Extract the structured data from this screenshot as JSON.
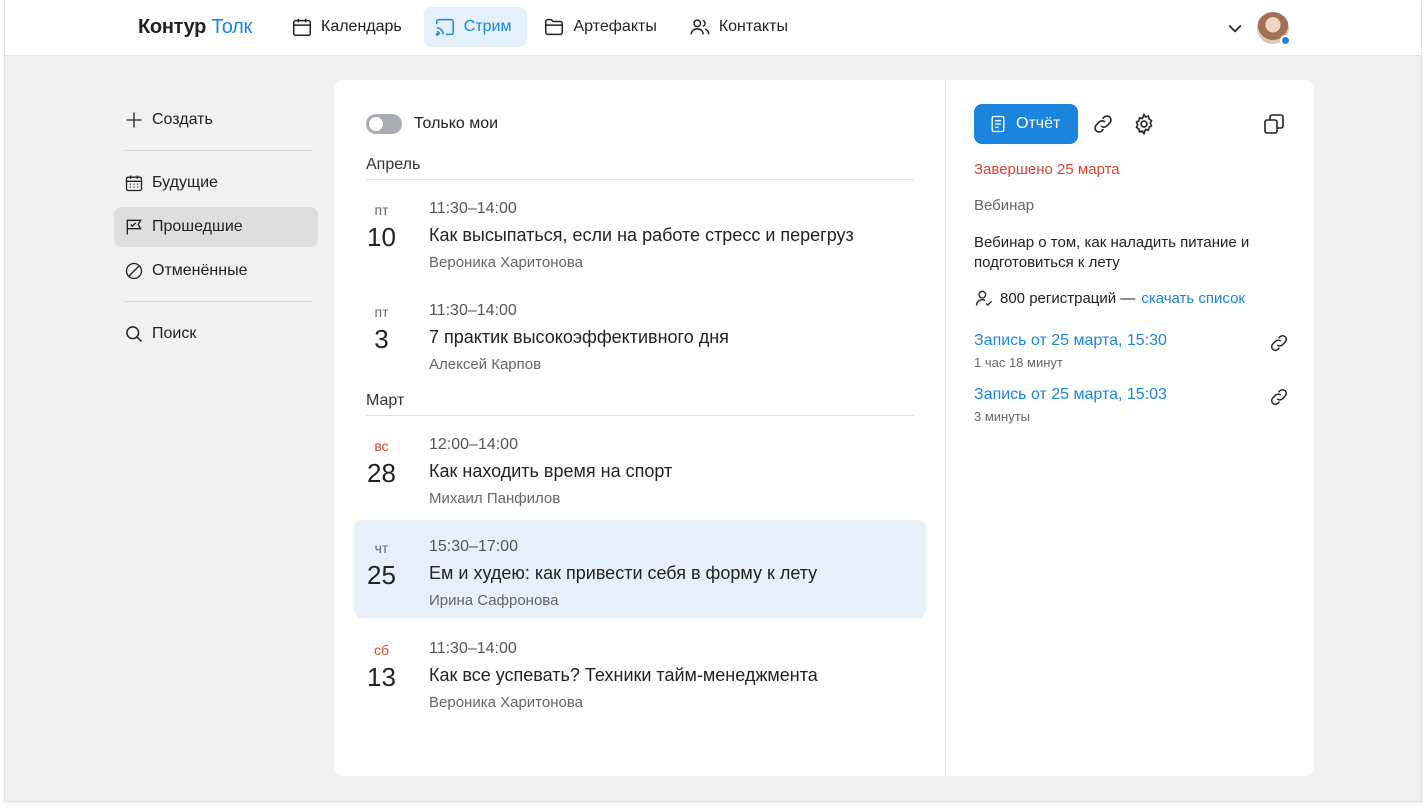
{
  "app": {
    "brand_1": "Контур",
    "brand_2": "Толк"
  },
  "nav": [
    {
      "label": "Календарь",
      "icon": "calendar-icon",
      "active": false
    },
    {
      "label": "Стрим",
      "icon": "stream-icon",
      "active": true
    },
    {
      "label": "Артефакты",
      "icon": "folder-icon",
      "active": false
    },
    {
      "label": "Контакты",
      "icon": "contacts-icon",
      "active": false
    }
  ],
  "sidebar": {
    "create": "Создать",
    "items": [
      {
        "label": "Будущие",
        "icon": "calendar-grid-icon"
      },
      {
        "label": "Прошедшие",
        "icon": "flag-icon",
        "active": true
      },
      {
        "label": "Отменённые",
        "icon": "cancel-icon"
      }
    ],
    "search": "Поиск"
  },
  "filter": {
    "only_mine": "Только мои",
    "enabled": false
  },
  "groups": [
    {
      "month": "Апрель",
      "events": [
        {
          "dow": "пт",
          "day": "10",
          "time": "11:30–14:00",
          "title": "Как высыпаться, если на работе стресс и перегруз",
          "host": "Вероника Харитонова"
        },
        {
          "dow": "пт",
          "day": "3",
          "time": "11:30–14:00",
          "title": "7 практик высокоэффективного дня",
          "host": "Алексей Карпов"
        }
      ]
    },
    {
      "month": "Март",
      "events": [
        {
          "dow": "вс",
          "day": "28",
          "time": "12:00–14:00",
          "title": "Как находить время на спорт",
          "host": "Михаил Панфилов"
        },
        {
          "dow": "чт",
          "day": "25",
          "time": "15:30–17:00",
          "title": "Ем и худею: как привести себя в форму к лету",
          "host": "Ирина Сафронова"
        },
        {
          "dow": "сб",
          "day": "13",
          "time": "11:30–14:00",
          "title": "Как все успевать? Техники тайм-менеджмента",
          "host": "Вероника Харитонова"
        }
      ]
    }
  ],
  "detail": {
    "report_label": "Отчёт",
    "status": "Завершено 25 марта",
    "type": "Вебинар",
    "description": "Вебинар о том, как наладить питание и подготовиться к лету",
    "registrations": "800 регистраций — ",
    "download_link": "скачать список",
    "recordings": [
      {
        "label": "Запись от 25 марта, 15:30",
        "duration": "1 час 18 минут"
      },
      {
        "label": "Запись от 25 марта, 15:03",
        "duration": "3 минуты"
      }
    ]
  },
  "colors": {
    "accent": "#1b84dd",
    "danger": "#d9442f",
    "selected_bg": "#e5f0fa"
  }
}
